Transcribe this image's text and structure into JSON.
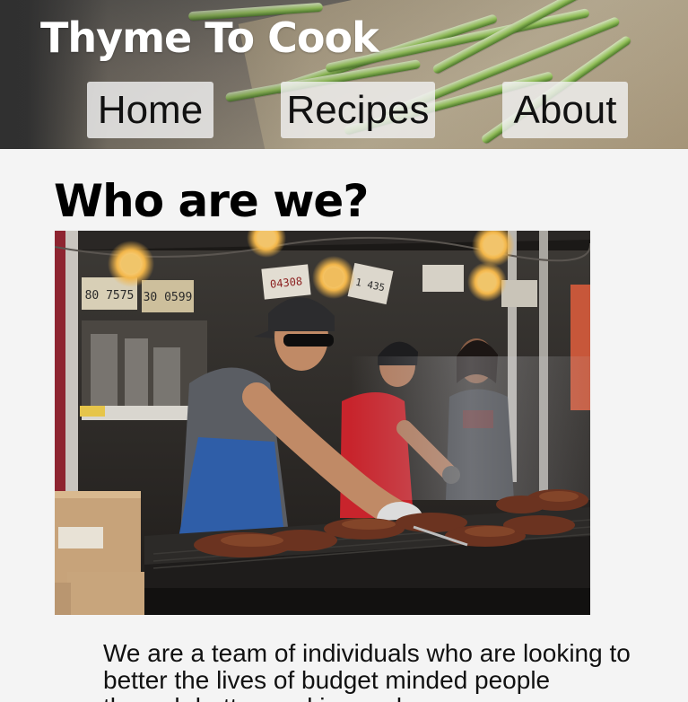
{
  "header": {
    "site_title": "Thyme To Cook",
    "nav": [
      {
        "label": "Home"
      },
      {
        "label": "Recipes"
      },
      {
        "label": "About"
      }
    ]
  },
  "main": {
    "heading": "Who are we?",
    "photo": {
      "signs": [
        "80 7575",
        "30 0599",
        "04308",
        "1 435"
      ]
    },
    "body_text": "We are a team of individuals who are looking to better the lives of budget minded people through better cooking and"
  },
  "colors": {
    "page_background": "#f4f4f4",
    "title_text": "#ffffff",
    "nav_button_background": "#f0f0f0",
    "heading_text": "#000000"
  }
}
